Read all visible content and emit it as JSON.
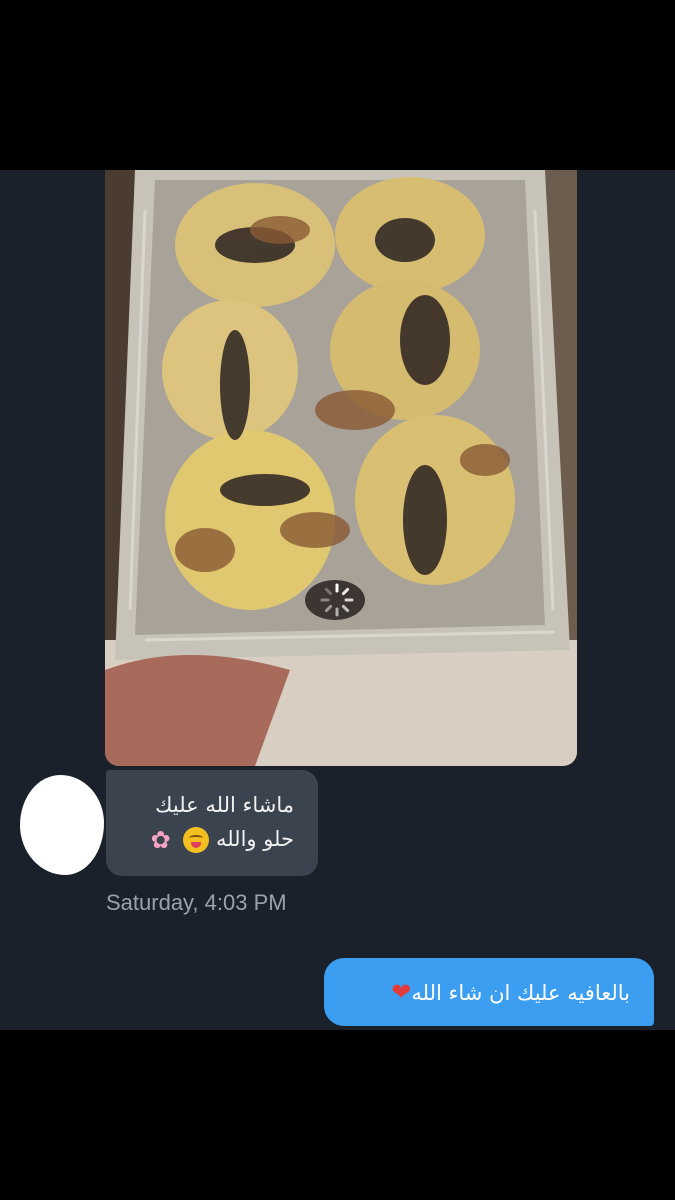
{
  "photo_message": {
    "description_icon": "food-tray-photo",
    "status": "loading"
  },
  "incoming_message": {
    "line1": "ماشاء الله عليك",
    "line2": "حلو والله",
    "emoji_face": "yum-face-emoji",
    "emoji_flower": "✿",
    "time": "Saturday, 4:03 PM"
  },
  "outgoing_message": {
    "text": "بالعافيه عليك ان شاء الله",
    "emoji": "❤"
  },
  "colors": {
    "chat_background": "#1a212b",
    "incoming_bubble": "#3a434e",
    "outgoing_bubble": "#3c9ef0",
    "letterbox": "#000000"
  }
}
